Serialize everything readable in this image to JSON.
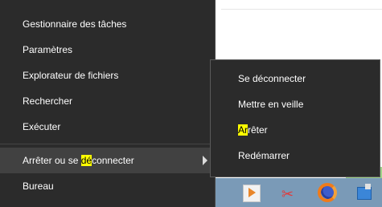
{
  "winx_menu": {
    "items": [
      {
        "label_pre": "Gestionnaire des t",
        "label_mid": "â",
        "label_post": "ches"
      },
      {
        "label_pre": "Param",
        "label_mid": "è",
        "label_post": "tres"
      },
      {
        "label": "Explorateur de fichiers"
      },
      {
        "label": "Rechercher"
      },
      {
        "label": "Exécuter"
      },
      {
        "label_pre": "Arrêter ou se ",
        "label_mid": "dé",
        "label_post": "connecter"
      },
      {
        "label": "Bureau"
      }
    ]
  },
  "submenu": {
    "items": [
      {
        "label": "Se déconnecter"
      },
      {
        "label": "Mettre en veille"
      },
      {
        "label_pre": "",
        "label_mid": "Ar",
        "label_post": "rêter"
      },
      {
        "label": "Redémarrer"
      }
    ]
  },
  "colors": {
    "menu_bg": "#2b2b2b",
    "highlight": "#ffff00",
    "taskbar": "#7a9ab7"
  }
}
